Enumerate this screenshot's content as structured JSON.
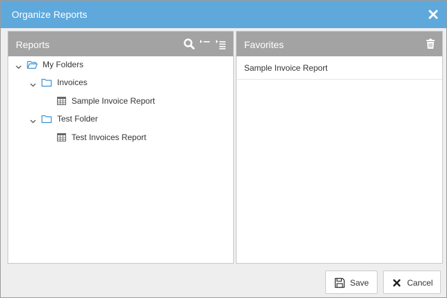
{
  "dialog": {
    "title": "Organize Reports"
  },
  "reports_panel": {
    "title": "Reports",
    "icons": [
      "search-icon",
      "collapse-all-icon",
      "expand-all-icon"
    ],
    "tree": [
      {
        "label": "My Folders",
        "icon": "folder-open-icon"
      },
      {
        "label": "Invoices",
        "icon": "folder-icon"
      },
      {
        "label": "Sample Invoice Report",
        "icon": "report-icon"
      },
      {
        "label": "Test Folder",
        "icon": "folder-icon"
      },
      {
        "label": "Test Invoices Report",
        "icon": "report-icon"
      }
    ]
  },
  "favorites_panel": {
    "title": "Favorites",
    "icons": [
      "trash-icon"
    ],
    "items": [
      "Sample Invoice Report"
    ]
  },
  "footer": {
    "save_label": "Save",
    "cancel_label": "Cancel"
  },
  "colors": {
    "title_bar": "#5ea8dc",
    "panel_header": "#a3a3a3",
    "folder_icon": "#3a8fd1",
    "dialog_bg": "#eeeeee"
  }
}
